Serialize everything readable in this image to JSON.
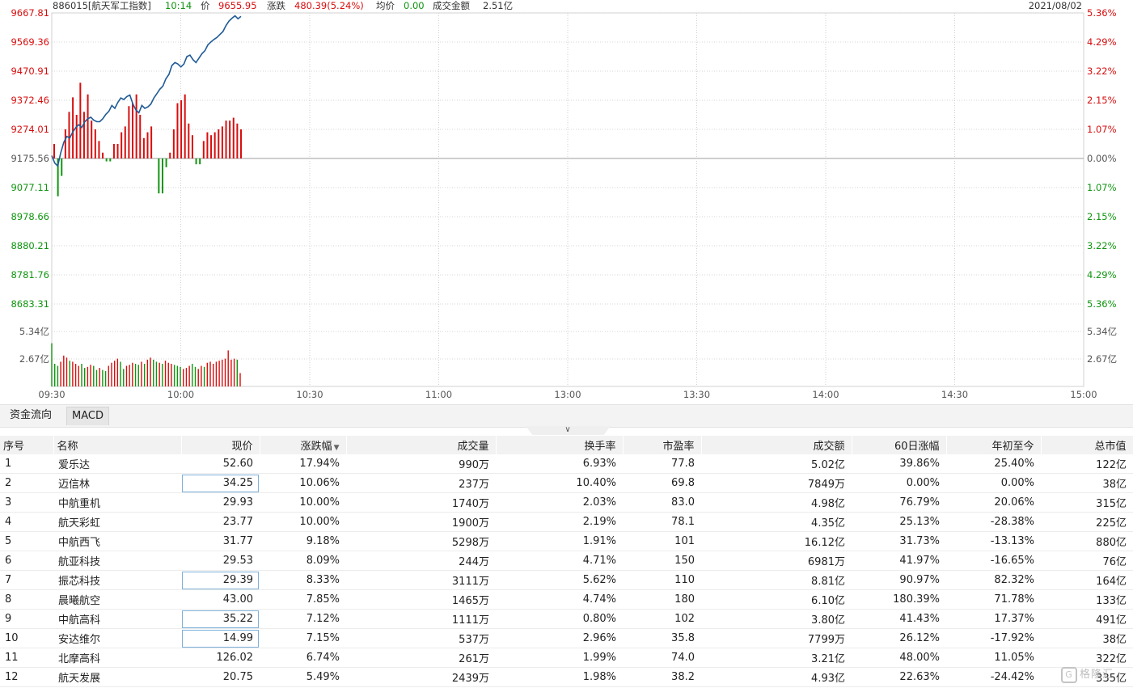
{
  "header": {
    "code_name": "886015[航天军工指数]",
    "time": "10:14",
    "price_label": "价",
    "price": "9655.95",
    "change_label": "涨跌",
    "change": "480.39(5.24%)",
    "avg_label": "均价",
    "avg": "0.00",
    "turnover_label": "成交金额",
    "turnover": "2.51亿",
    "date": "2021/08/02"
  },
  "colors": {
    "up": "#d80e0e",
    "down": "#109510",
    "price_line": "#1f5a96",
    "grid": "#c9c9c9"
  },
  "chart_data": {
    "type": "line",
    "title": "",
    "y_left_labels": [
      "9667.81",
      "9569.36",
      "9470.91",
      "9372.46",
      "9274.01",
      "9175.56",
      "9077.11",
      "8978.66",
      "8880.21",
      "8781.76",
      "8683.31"
    ],
    "y_right_labels": [
      "5.36%",
      "4.29%",
      "3.22%",
      "2.15%",
      "1.07%",
      "0.00%",
      "1.07%",
      "2.15%",
      "3.22%",
      "4.29%",
      "5.36%"
    ],
    "volume_labels": [
      "5.34亿",
      "2.67亿"
    ],
    "x_labels": [
      "09:30",
      "10:00",
      "10:30",
      "11:00",
      "13:00",
      "13:30",
      "14:00",
      "14:30",
      "15:00"
    ],
    "ylim": [
      8683.31,
      9667.81
    ],
    "prev_close": 9175.56,
    "volume_max": 5.34,
    "price": [
      9185,
      9160,
      9150,
      9195,
      9230,
      9250,
      9245,
      9265,
      9280,
      9290,
      9280,
      9300,
      9310,
      9315,
      9305,
      9300,
      9300,
      9310,
      9325,
      9335,
      9355,
      9345,
      9365,
      9380,
      9375,
      9385,
      9390,
      9360,
      9340,
      9330,
      9355,
      9345,
      9350,
      9360,
      9380,
      9395,
      9410,
      9420,
      9445,
      9460,
      9490,
      9500,
      9495,
      9485,
      9495,
      9520,
      9525,
      9510,
      9500,
      9515,
      9530,
      9540,
      9560,
      9570,
      9578,
      9585,
      9595,
      9605,
      9625,
      9640,
      9650,
      9658,
      9648,
      9656
    ],
    "volume": [
      4.2,
      2.2,
      2.0,
      2.4,
      3.0,
      2.8,
      2.5,
      2.4,
      2.2,
      2.0,
      2.2,
      1.8,
      1.9,
      2.1,
      2.0,
      1.6,
      1.8,
      1.6,
      1.5,
      2.0,
      2.3,
      2.5,
      2.7,
      2.4,
      1.7,
      2.0,
      2.1,
      2.3,
      2.2,
      2.1,
      2.4,
      2.2,
      2.6,
      2.8,
      2.6,
      2.4,
      2.3,
      2.2,
      2.5,
      2.3,
      2.2,
      2.1,
      2.0,
      1.9,
      1.7,
      1.8,
      2.0,
      2.2,
      1.9,
      1.7,
      2.0,
      1.9,
      2.3,
      2.4,
      2.2,
      2.4,
      2.5,
      2.6,
      2.7,
      3.5,
      2.6,
      2.7,
      2.6,
      1.3
    ],
    "volume_up": [
      false,
      false,
      false,
      true,
      true,
      true,
      false,
      true,
      true,
      true,
      false,
      false,
      true,
      true,
      false,
      false,
      true,
      false,
      false,
      true,
      true,
      true,
      true,
      false,
      false,
      true,
      true,
      true,
      false,
      false,
      true,
      false,
      true,
      true,
      false,
      false,
      true,
      false,
      true,
      true,
      true,
      false,
      false,
      false,
      true,
      true,
      true,
      false,
      false,
      true,
      true,
      false,
      true,
      true,
      true,
      true,
      true,
      true,
      true,
      true,
      true,
      true,
      false,
      true
    ],
    "breadth": [
      0.5,
      -1.3,
      -0.6,
      1.0,
      1.6,
      2.1,
      1.5,
      2.6,
      1.6,
      2.2,
      1.3,
      1.0,
      0.6,
      0.2,
      -0.1,
      -0.1,
      0.5,
      0.5,
      0.9,
      1.1,
      1.8,
      1.9,
      2.2,
      1.5,
      0.7,
      0.9,
      1.1,
      0,
      -1.2,
      -1.2,
      -0.3,
      0.2,
      1.0,
      1.9,
      2.0,
      2.2,
      1.2,
      0.8,
      -0.2,
      -0.2,
      0.6,
      0.9,
      0.8,
      0.9,
      1.0,
      1.1,
      1.3,
      1.3,
      1.4,
      1.2,
      1.0
    ]
  },
  "tabs": [
    "资金流向",
    "MACD"
  ],
  "table": {
    "headers": [
      "序号",
      "名称",
      "现价",
      "涨跌幅",
      "成交量",
      "换手率",
      "市盈率",
      "成交额",
      "60日涨幅",
      "年初至今",
      "总市值"
    ],
    "rows": [
      {
        "no": "1",
        "name": "爱乐达",
        "price": "52.60",
        "pct": "17.94%",
        "vol": "990万",
        "turnover_rate": "6.93%",
        "pe": "77.8",
        "amount": "5.02亿",
        "d60": "39.86%",
        "ytd": "25.40%",
        "ytd_up": true,
        "d60_up": true,
        "cap": "122亿",
        "boxed": false
      },
      {
        "no": "2",
        "name": "迈信林",
        "price": "34.25",
        "pct": "10.06%",
        "vol": "237万",
        "turnover_rate": "10.40%",
        "pe": "69.8",
        "amount": "7849万",
        "d60": "0.00%",
        "ytd": "0.00%",
        "ytd_up": null,
        "d60_up": null,
        "cap": "38亿",
        "boxed": true
      },
      {
        "no": "3",
        "name": "中航重机",
        "price": "29.93",
        "pct": "10.00%",
        "vol": "1740万",
        "turnover_rate": "2.03%",
        "pe": "83.0",
        "amount": "4.98亿",
        "d60": "76.79%",
        "ytd": "20.06%",
        "ytd_up": true,
        "d60_up": true,
        "cap": "315亿",
        "boxed": false
      },
      {
        "no": "4",
        "name": "航天彩虹",
        "price": "23.77",
        "pct": "10.00%",
        "vol": "1900万",
        "turnover_rate": "2.19%",
        "pe": "78.1",
        "amount": "4.35亿",
        "d60": "25.13%",
        "ytd": "-28.38%",
        "ytd_up": false,
        "d60_up": true,
        "cap": "225亿",
        "boxed": false
      },
      {
        "no": "5",
        "name": "中航西飞",
        "price": "31.77",
        "pct": "9.18%",
        "vol": "5298万",
        "turnover_rate": "1.91%",
        "pe": "101",
        "amount": "16.12亿",
        "d60": "31.73%",
        "ytd": "-13.13%",
        "ytd_up": false,
        "d60_up": true,
        "cap": "880亿",
        "boxed": false
      },
      {
        "no": "6",
        "name": "航亚科技",
        "price": "29.53",
        "pct": "8.09%",
        "vol": "244万",
        "turnover_rate": "4.71%",
        "pe": "150",
        "amount": "6981万",
        "d60": "41.97%",
        "ytd": "-16.65%",
        "ytd_up": false,
        "d60_up": true,
        "cap": "76亿",
        "boxed": false
      },
      {
        "no": "7",
        "name": "振芯科技",
        "price": "29.39",
        "pct": "8.33%",
        "vol": "3111万",
        "turnover_rate": "5.62%",
        "pe": "110",
        "amount": "8.81亿",
        "d60": "90.97%",
        "ytd": "82.32%",
        "ytd_up": true,
        "d60_up": true,
        "cap": "164亿",
        "boxed": true
      },
      {
        "no": "8",
        "name": "晨曦航空",
        "price": "43.00",
        "pct": "7.85%",
        "vol": "1465万",
        "turnover_rate": "4.74%",
        "pe": "180",
        "amount": "6.10亿",
        "d60": "180.39%",
        "ytd": "71.78%",
        "ytd_up": true,
        "d60_up": true,
        "cap": "133亿",
        "boxed": false
      },
      {
        "no": "9",
        "name": "中航高科",
        "price": "35.22",
        "pct": "7.12%",
        "vol": "1111万",
        "turnover_rate": "0.80%",
        "pe": "102",
        "amount": "3.80亿",
        "d60": "41.43%",
        "ytd": "17.37%",
        "ytd_up": true,
        "d60_up": true,
        "cap": "491亿",
        "boxed": true
      },
      {
        "no": "10",
        "name": "安达维尔",
        "price": "14.99",
        "pct": "7.15%",
        "vol": "537万",
        "turnover_rate": "2.96%",
        "pe": "35.8",
        "amount": "7799万",
        "d60": "26.12%",
        "ytd": "-17.92%",
        "ytd_up": false,
        "d60_up": true,
        "cap": "38亿",
        "boxed": true
      },
      {
        "no": "11",
        "name": "北摩高科",
        "price": "126.02",
        "pct": "6.74%",
        "vol": "261万",
        "turnover_rate": "1.99%",
        "pe": "74.0",
        "amount": "3.21亿",
        "d60": "48.00%",
        "ytd": "11.05%",
        "ytd_up": true,
        "d60_up": true,
        "cap": "322亿",
        "boxed": false
      },
      {
        "no": "12",
        "name": "航天发展",
        "price": "20.75",
        "pct": "5.49%",
        "vol": "2439万",
        "turnover_rate": "1.98%",
        "pe": "38.2",
        "amount": "4.93亿",
        "d60": "22.63%",
        "ytd": "-24.42%",
        "ytd_up": false,
        "d60_up": true,
        "cap": "335亿",
        "boxed": false
      }
    ]
  },
  "watermark": {
    "text": "格隆汇",
    "logo_icon": "G"
  }
}
